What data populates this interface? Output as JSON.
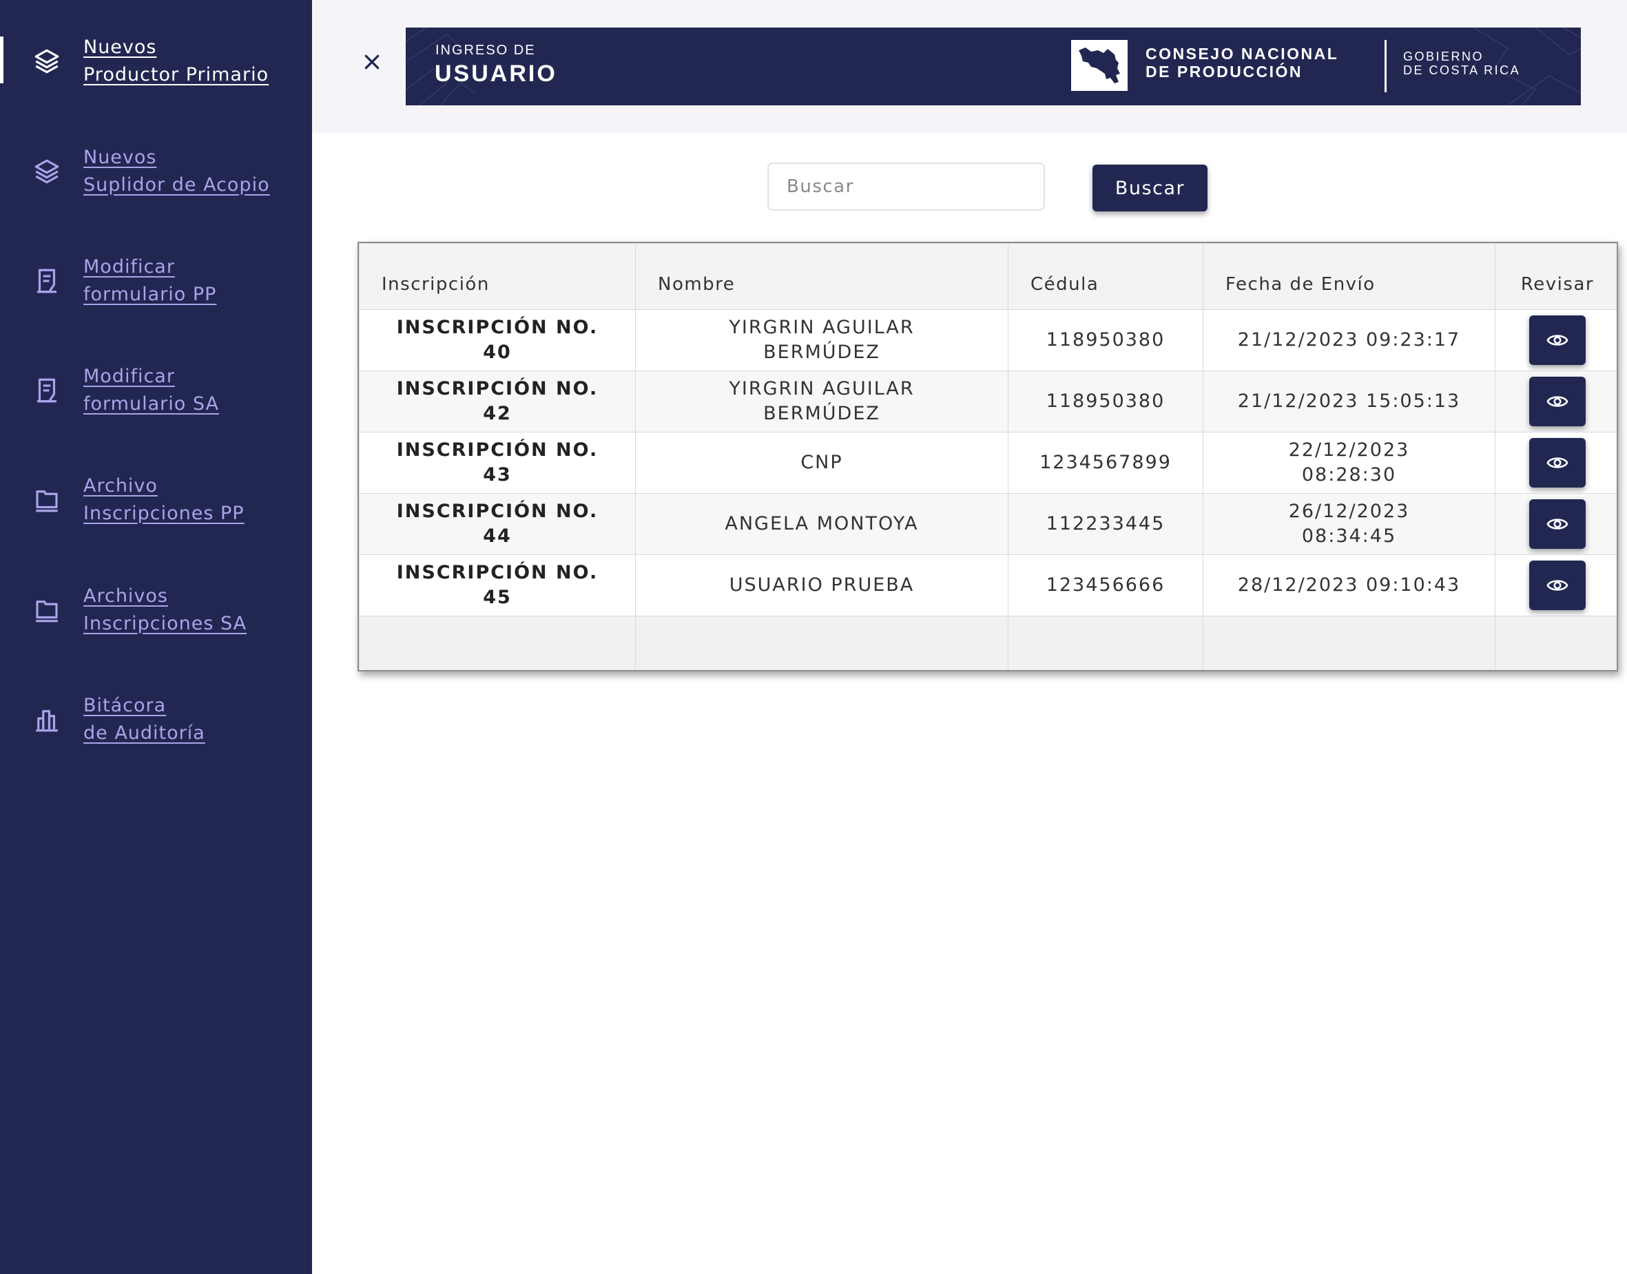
{
  "sidebar": {
    "items": [
      {
        "line1": "Nuevos",
        "line2": "Productor Primario",
        "icon": "layers-icon",
        "active": true
      },
      {
        "line1": "Nuevos",
        "line2": "Suplidor de Acopio",
        "icon": "layers-icon",
        "active": false
      },
      {
        "line1": "Modificar",
        "line2": "formulario PP",
        "icon": "document-icon",
        "active": false
      },
      {
        "line1": "Modificar",
        "line2": "formulario SA",
        "icon": "document-icon",
        "active": false
      },
      {
        "line1": "Archivo",
        "line2": "Inscripciones PP",
        "icon": "folder-icon",
        "active": false
      },
      {
        "line1": "Archivos",
        "line2": "Inscripciones SA",
        "icon": "folder-icon",
        "active": false
      },
      {
        "line1": "Bitácora",
        "line2": "de Auditoría",
        "icon": "bar-chart-icon",
        "active": false
      }
    ]
  },
  "header": {
    "close_icon": "close-icon",
    "banner": {
      "subtitle": "INGRESO DE",
      "title": "USUARIO",
      "org_line1": "CONSEJO NACIONAL",
      "org_line2": "DE PRODUCCIÓN",
      "gov_line1": "GOBIERNO",
      "gov_line2": "DE COSTA RICA",
      "logo_icon": "costa-rica-map-icon"
    }
  },
  "search": {
    "placeholder": "Buscar",
    "value": "",
    "button_label": "Buscar"
  },
  "table": {
    "headers": {
      "inscripcion": "Inscripción",
      "nombre": "Nombre",
      "cedula": "Cédula",
      "fecha": "Fecha de Envío",
      "revisar": "Revisar"
    },
    "rows": [
      {
        "inscripcion_1": "INSCRIPCIÓN NO.",
        "inscripcion_2": "40",
        "nombre_1": "YIRGRIN AGUILAR",
        "nombre_2": "BERMÚDEZ",
        "cedula": "118950380",
        "fecha_1": "21/12/2023 09:23:17",
        "fecha_2": ""
      },
      {
        "inscripcion_1": "INSCRIPCIÓN NO.",
        "inscripcion_2": "42",
        "nombre_1": "YIRGRIN AGUILAR",
        "nombre_2": "BERMÚDEZ",
        "cedula": "118950380",
        "fecha_1": "21/12/2023 15:05:13",
        "fecha_2": ""
      },
      {
        "inscripcion_1": "INSCRIPCIÓN NO.",
        "inscripcion_2": "43",
        "nombre_1": "CNP",
        "nombre_2": "",
        "cedula": "1234567899",
        "fecha_1": "22/12/2023",
        "fecha_2": "08:28:30"
      },
      {
        "inscripcion_1": "INSCRIPCIÓN NO.",
        "inscripcion_2": "44",
        "nombre_1": "ANGELA MONTOYA",
        "nombre_2": "",
        "cedula": "112233445",
        "fecha_1": "26/12/2023",
        "fecha_2": "08:34:45"
      },
      {
        "inscripcion_1": "INSCRIPCIÓN NO.",
        "inscripcion_2": "45",
        "nombre_1": "USUARIO PRUEBA",
        "nombre_2": "",
        "cedula": "123456666",
        "fecha_1": "28/12/2023 09:10:43",
        "fecha_2": ""
      }
    ],
    "action_icon": "eye-icon"
  },
  "colors": {
    "brand_navy": "#222752",
    "sidebar_link": "#a9a4e8",
    "page_bg": "#ffffff",
    "top_bar_bg": "#f5f5f9"
  }
}
